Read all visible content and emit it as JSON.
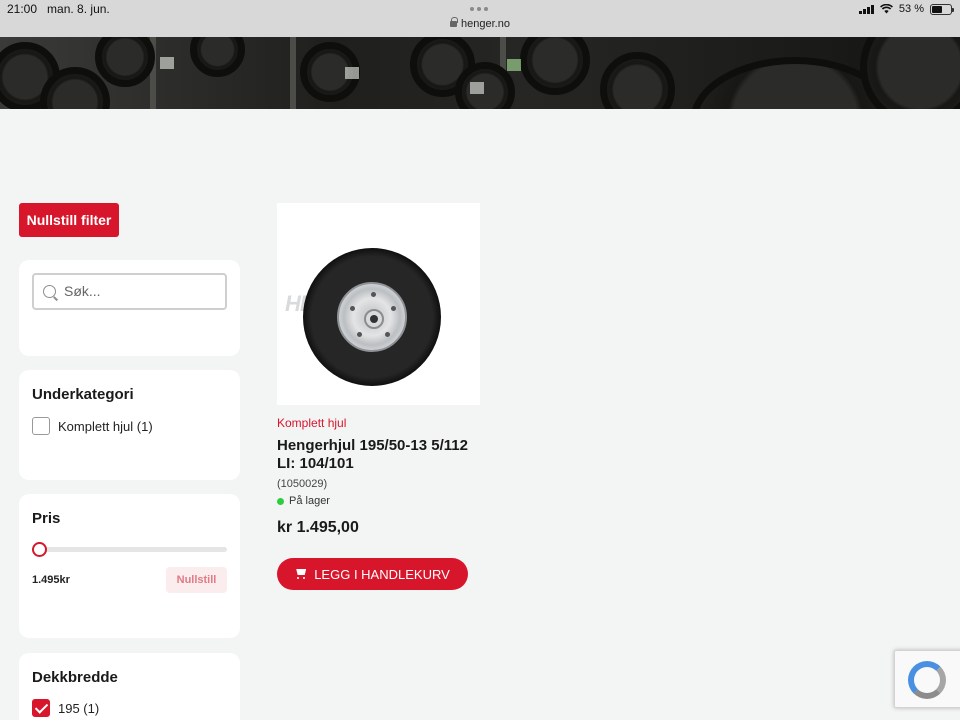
{
  "status_bar": {
    "time": "21:00",
    "date": "man. 8. jun.",
    "url": "henger.no",
    "battery": "53 %"
  },
  "filters": {
    "reset_label": "Nullstill filter",
    "search_placeholder": "Søk...",
    "subcategory": {
      "title": "Underkategori",
      "options": [
        {
          "label": "Komplett hjul (1)",
          "checked": false
        }
      ]
    },
    "price": {
      "title": "Pris",
      "value": "1.495kr",
      "reset_label": "Nullstill"
    },
    "tire_width": {
      "title": "Dekkbredde",
      "options": [
        {
          "label": "195 (1)",
          "checked": true
        }
      ]
    }
  },
  "product": {
    "image_watermark": "HENGER.NO",
    "category": "Komplett hjul",
    "title": "Hengerhjul 195/50-13 5/112 LI: 104/101",
    "sku": "(1050029)",
    "stock": "På lager",
    "price": "kr 1.495,00",
    "cart_button_label": "LEGG I HANDLEKURV"
  },
  "colors": {
    "brand_red": "#d7162b",
    "in_stock_green": "#2ecc40"
  }
}
